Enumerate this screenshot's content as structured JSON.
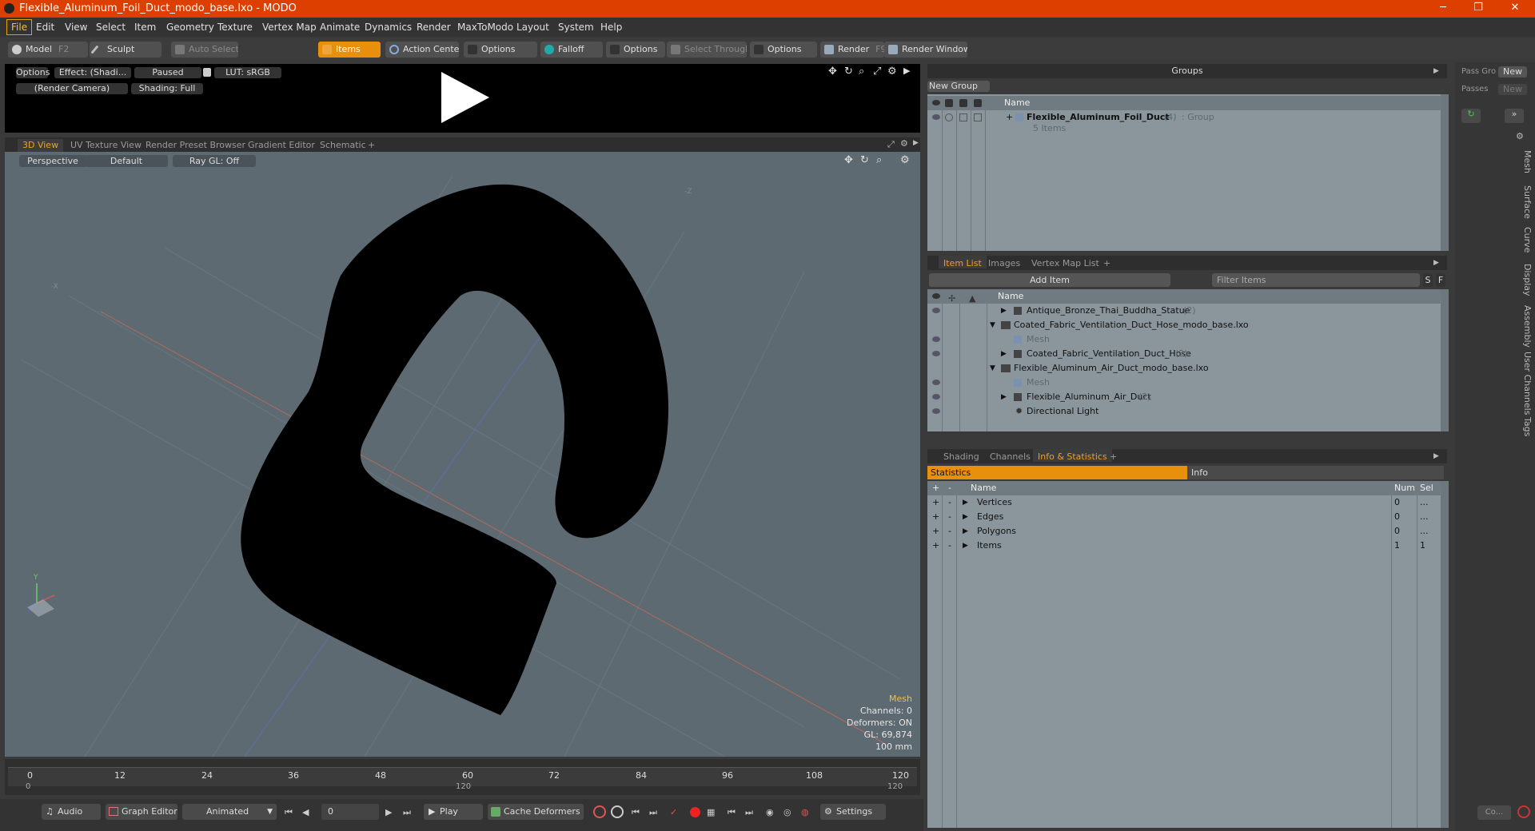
{
  "window": {
    "title": "Flexible_Aluminum_Foil_Duct_modo_base.lxo - MODO",
    "minimize": "─",
    "maximize": "❐",
    "close": "✕"
  },
  "menu": [
    "File",
    "Edit",
    "View",
    "Select",
    "Item",
    "Geometry",
    "Texture",
    "Vertex Map",
    "Animate",
    "Dynamics",
    "Render",
    "MaxToModo",
    "Layout",
    "System",
    "Help"
  ],
  "toolbar": {
    "model": "Model",
    "model_key": "F2",
    "sculpt": "Sculpt",
    "auto_select": "Auto Select",
    "items": "Items",
    "action_center": "Action Center",
    "options1": "Options",
    "falloff": "Falloff",
    "options2": "Options",
    "select_through": "Select Through",
    "options3": "Options",
    "render": "Render",
    "render_key": "F9",
    "render_window": "Render Window"
  },
  "preview": {
    "options": "Options",
    "effect": "Effect: (Shadi...",
    "paused": "Paused",
    "lut": "LUT: sRGB",
    "camera": "(Render Camera)",
    "shading": "Shading: Full"
  },
  "viewport_tabs": [
    "3D View",
    "UV Texture View",
    "Render Preset Browser",
    "Gradient Editor",
    "Schematic",
    "+"
  ],
  "viewport": {
    "perspective": "Perspective",
    "default": "Default",
    "raygl": "Ray GL: Off",
    "info": {
      "mesh": "Mesh",
      "channels": "Channels: 0",
      "deformers": "Deformers: ON",
      "gl": "GL: 69,874",
      "scale": "100 mm"
    },
    "axis_y": "Y",
    "axis_z": "-Z",
    "axis_x": "-X"
  },
  "timeline": {
    "ticks": [
      "0",
      "12",
      "24",
      "36",
      "48",
      "60",
      "72",
      "84",
      "96",
      "108",
      "120"
    ],
    "sub_start": "0",
    "sub_mid": "120",
    "sub_end": "120"
  },
  "bottom": {
    "audio": "Audio",
    "graph_editor": "Graph Editor",
    "animated": "Animated",
    "frame": "0",
    "play": "Play",
    "cache": "Cache Deformers",
    "settings": "Settings"
  },
  "groups": {
    "title": "Groups",
    "new_group": "New Group",
    "col_name": "Name",
    "item": "Flexible_Aluminum_Foil_Duct",
    "item_count": "(4)",
    "item_type": ": Group",
    "sub": "5 Items"
  },
  "pass": {
    "pass_groups": "Pass Gro",
    "new1": "New",
    "passes": "Passes",
    "new2": "New"
  },
  "itemlist": {
    "tabs": [
      "Item List",
      "Images",
      "Vertex Map List",
      "+"
    ],
    "add_item": "Add Item",
    "filter": "Filter Items",
    "s": "S",
    "f": "F",
    "col_name": "Name",
    "rows": [
      {
        "label": "Antique_Bronze_Thai_Buddha_Statue",
        "count": "(2)"
      },
      {
        "label": "Coated_Fabric_Ventilation_Duct_Hose_modo_base.lxo",
        "count": ""
      },
      {
        "label": "Mesh",
        "count": ""
      },
      {
        "label": "Coated_Fabric_Ventilation_Duct_Hose",
        "count": "(2)"
      },
      {
        "label": "Flexible_Aluminum_Air_Duct_modo_base.lxo",
        "count": ""
      },
      {
        "label": "Mesh",
        "count": ""
      },
      {
        "label": "Flexible_Aluminum_Air_Duct",
        "count": "(2)"
      },
      {
        "label": "Directional Light",
        "count": ""
      }
    ]
  },
  "stats": {
    "tabs": [
      "Shading",
      "Channels",
      "Info & Statistics",
      "+"
    ],
    "statistics": "Statistics",
    "info": "Info",
    "cols": {
      "name": "Name",
      "num": "Num",
      "sel": "Sel"
    },
    "rows": [
      {
        "name": "Vertices",
        "num": "0",
        "sel": "..."
      },
      {
        "name": "Edges",
        "num": "0",
        "sel": "..."
      },
      {
        "name": "Polygons",
        "num": "0",
        "sel": "..."
      },
      {
        "name": "Items",
        "num": "1",
        "sel": "1"
      }
    ]
  },
  "side_tabs": [
    "Mesh",
    "Surface",
    "Curve",
    "Display",
    "Assembly",
    "User Channels",
    "Tags"
  ],
  "corner": {
    "co": "Co..."
  },
  "colors": {
    "accent": "#e8900c",
    "titlebar": "#dd3f00",
    "viewport": "#5e6a72"
  }
}
